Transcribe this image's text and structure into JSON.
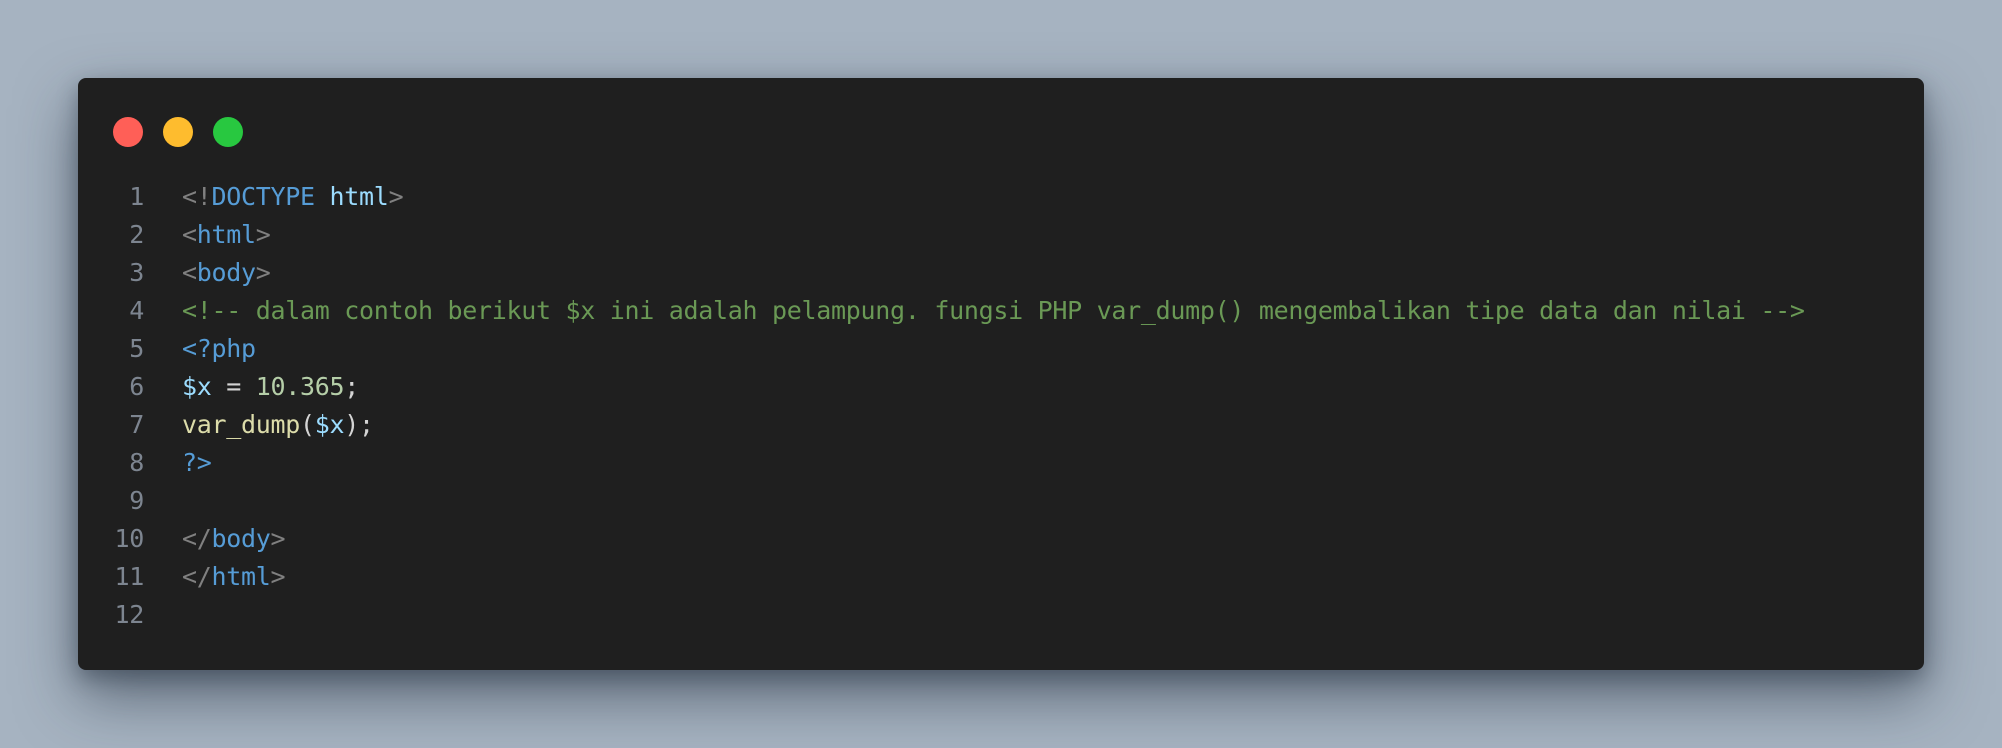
{
  "theme": {
    "page_background": "#a6b3c1",
    "window_background": "#1f1f1f",
    "traffic_lights": [
      "#ff5f57",
      "#febc2e",
      "#28c840"
    ]
  },
  "window": {
    "controls": [
      {
        "name": "close-button",
        "color": "#ff5f57"
      },
      {
        "name": "minimize-button",
        "color": "#febc2e"
      },
      {
        "name": "maximize-button",
        "color": "#28c840"
      }
    ]
  },
  "code": {
    "language": "php",
    "lines": [
      {
        "n": "1",
        "tokens": [
          [
            "punct",
            "<!"
          ],
          [
            "tag",
            "DOCTYPE"
          ],
          [
            "op",
            " "
          ],
          [
            "attr",
            "html"
          ],
          [
            "punct",
            ">"
          ]
        ]
      },
      {
        "n": "2",
        "tokens": [
          [
            "punct",
            "<"
          ],
          [
            "tag",
            "html"
          ],
          [
            "punct",
            ">"
          ]
        ]
      },
      {
        "n": "3",
        "tokens": [
          [
            "punct",
            "<"
          ],
          [
            "tag",
            "body"
          ],
          [
            "punct",
            ">"
          ]
        ]
      },
      {
        "n": "4",
        "tokens": [
          [
            "comment",
            "<!-- dalam contoh berikut $x ini adalah pelampung. fungsi PHP var_dump() mengembalikan tipe data dan nilai -->"
          ]
        ]
      },
      {
        "n": "5",
        "tokens": [
          [
            "tag",
            "<?php"
          ]
        ]
      },
      {
        "n": "6",
        "tokens": [
          [
            "var",
            "$x"
          ],
          [
            "op",
            " = "
          ],
          [
            "num",
            "10.365"
          ],
          [
            "op",
            ";"
          ]
        ]
      },
      {
        "n": "7",
        "tokens": [
          [
            "fn",
            "var_dump"
          ],
          [
            "op",
            "("
          ],
          [
            "var",
            "$x"
          ],
          [
            "op",
            ");"
          ]
        ]
      },
      {
        "n": "8",
        "tokens": [
          [
            "tag",
            "?>"
          ]
        ]
      },
      {
        "n": "9",
        "tokens": []
      },
      {
        "n": "10",
        "tokens": [
          [
            "punct",
            "</"
          ],
          [
            "tag",
            "body"
          ],
          [
            "punct",
            ">"
          ]
        ]
      },
      {
        "n": "11",
        "tokens": [
          [
            "punct",
            "</"
          ],
          [
            "tag",
            "html"
          ],
          [
            "punct",
            ">"
          ]
        ]
      },
      {
        "n": "12",
        "tokens": []
      }
    ]
  }
}
